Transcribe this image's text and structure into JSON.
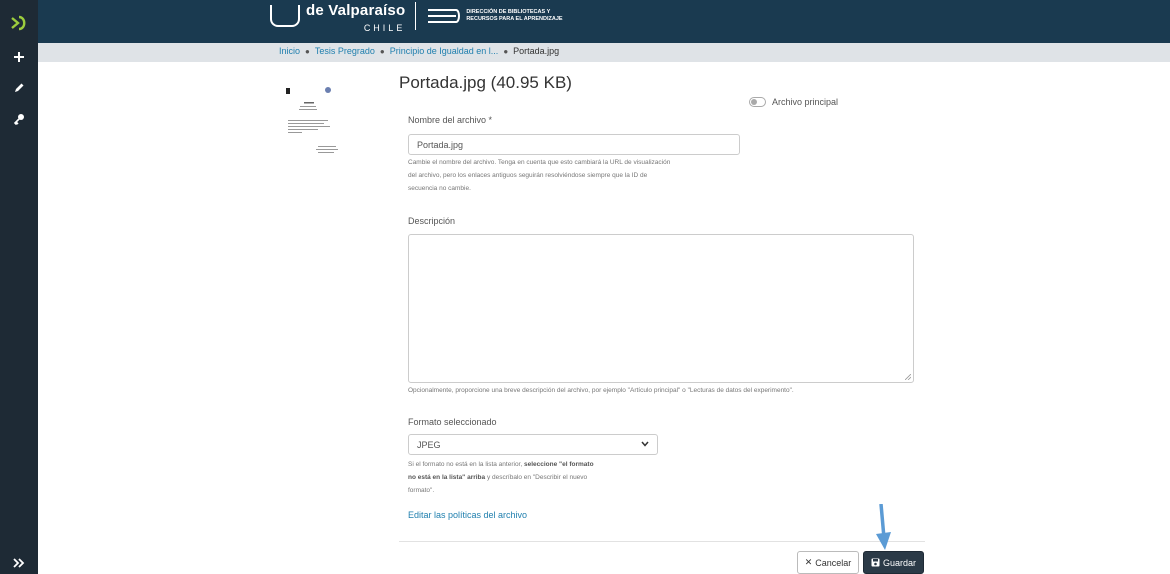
{
  "breadcrumb": {
    "items": [
      "Inicio",
      "Tesis Pregrado",
      "Principio de Igualdad en l..."
    ],
    "current": "Portada.jpg"
  },
  "header": {
    "uni_name": "de Valparaíso",
    "uni_country": "CHILE",
    "lib_line1": "DIRECCIÓN DE BIBLIOTECAS Y",
    "lib_line2": "RECURSOS PARA EL APRENDIZAJE"
  },
  "file": {
    "title": "Portada.jpg (40.95 KB)",
    "primary_toggle_label": "Archivo principal",
    "primary": false
  },
  "form": {
    "name_label": "Nombre del archivo *",
    "name_value": "Portada.jpg",
    "name_help_1": "Cambie el nombre del archivo. Tenga en cuenta que esto cambiará la URL de visualización",
    "name_help_2": "del archivo, pero los enlaces antiguos seguirán resolviéndose siempre que la ID de",
    "name_help_3": "secuencia no cambie.",
    "description_label": "Descripción",
    "description_value": "",
    "description_help": "Opcionalmente, proporcione una breve descripción del archivo, por ejemplo \"Artículo principal\" o \"Lecturas de datos del experimento\".",
    "format_label": "Formato seleccionado",
    "format_value": "JPEG",
    "format_help_1a": "Si el formato no está en la lista anterior, ",
    "format_help_1b": "seleccione \"el formato",
    "format_help_2a": "no está en la lista\" arriba",
    "format_help_2b": " y descríbalo en \"Describir el nuevo",
    "format_help_3": "formato\".",
    "policies_link": "Editar las políticas del archivo"
  },
  "actions": {
    "cancel_label": "Cancelar",
    "save_label": "Guardar"
  },
  "colors": {
    "sidebar": "#1e2a35",
    "topbar": "#1a3a50",
    "link": "#1f7fae",
    "arrow": "#5b9bd5"
  }
}
